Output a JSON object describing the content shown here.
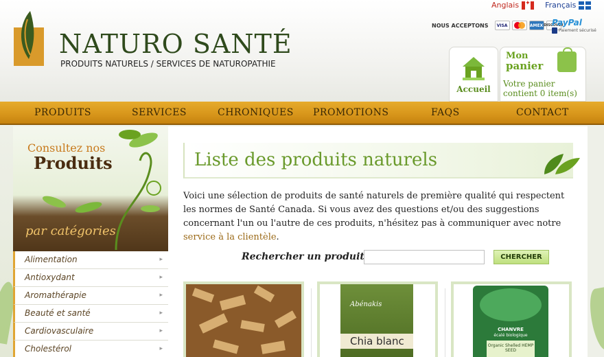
{
  "header": {
    "brand": "NATURO SANTÉ",
    "tagline": "PRODUITS NATURELS / SERVICES DE NATUROPATHIE",
    "languages": [
      "Anglais",
      "Français"
    ],
    "accept_label": "NOUS ACCEPTONS",
    "cards": [
      "VISA",
      "MC",
      "AMEX",
      "DISCOVER"
    ],
    "paypal_label": "PayPal",
    "paypal_sub": "Paiement sécurisé",
    "home_label": "Accueil",
    "cart_title_1": "Mon",
    "cart_title_2": "panier",
    "cart_info": "Votre panier contient 0 item(s)"
  },
  "nav": [
    "PRODUITS",
    "SERVICES",
    "CHRONIQUES",
    "PROMOTIONS",
    "FAQS",
    "CONTACT"
  ],
  "sidebar": {
    "line1": "Consultez nos",
    "line2": "Produits",
    "line3": "par catégories",
    "categories": [
      "Alimentation",
      "Antioxydant",
      "Aromathérapie",
      "Beauté et santé",
      "Cardiovasculaire",
      "Cholestérol"
    ]
  },
  "main": {
    "title": "Liste des produits naturels",
    "intro": "Voici une sélection de produits de santé naturels de première qualité qui respectent les normes de Santé Canada. Si vous avez des questions et/ou des suggestions concernant l'un ou l'autre de ces produits, n'hésitez pas à communiquer avec notre ",
    "intro_link": "service à la clientèle",
    "intro_end": ".",
    "search_label": "Rechercher un produit :",
    "search_value": "",
    "search_button": "CHERCHER",
    "products": [
      {
        "label": ""
      },
      {
        "label": "Chia blanc",
        "brand": "Abénakis"
      },
      {
        "label": "CHANVRE",
        "sub": "écalé biologique",
        "sub2": "Organic Shelled HEMP SEED"
      }
    ]
  },
  "colors": {
    "nav_gold": "#d7951a",
    "brand_green": "#2f4a1c",
    "accent_green": "#6a9a2c"
  }
}
